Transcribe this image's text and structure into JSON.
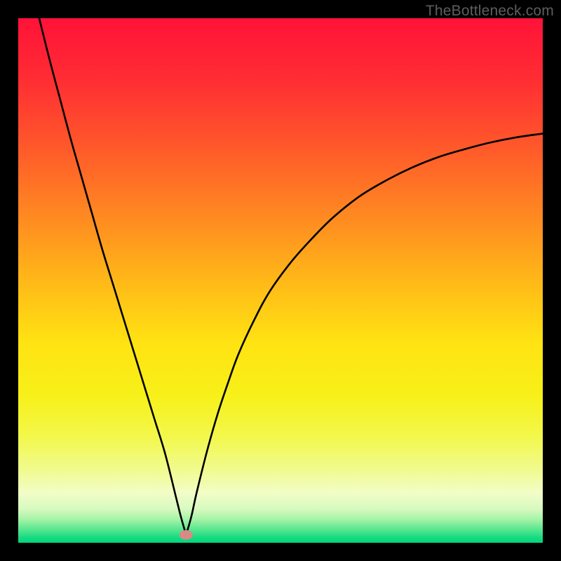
{
  "watermark": "TheBottleneck.com",
  "chart_data": {
    "type": "line",
    "title": "",
    "xlabel": "",
    "ylabel": "",
    "xlim": [
      0,
      100
    ],
    "ylim": [
      0,
      100
    ],
    "gradient_stops": [
      {
        "pos": 0.0,
        "color": "#ff1238"
      },
      {
        "pos": 0.12,
        "color": "#ff2e33"
      },
      {
        "pos": 0.25,
        "color": "#ff5a2a"
      },
      {
        "pos": 0.38,
        "color": "#ff8a21"
      },
      {
        "pos": 0.5,
        "color": "#ffb818"
      },
      {
        "pos": 0.62,
        "color": "#ffe312"
      },
      {
        "pos": 0.72,
        "color": "#f7f019"
      },
      {
        "pos": 0.8,
        "color": "#f3f84d"
      },
      {
        "pos": 0.86,
        "color": "#f0fb8e"
      },
      {
        "pos": 0.905,
        "color": "#f2fdc7"
      },
      {
        "pos": 0.935,
        "color": "#d8fac0"
      },
      {
        "pos": 0.955,
        "color": "#a7f3a8"
      },
      {
        "pos": 0.975,
        "color": "#57e68f"
      },
      {
        "pos": 0.99,
        "color": "#17db82"
      },
      {
        "pos": 1.0,
        "color": "#00d67b"
      }
    ],
    "minimum_x": 32,
    "marker": {
      "x": 32,
      "y": 1.5,
      "color": "#d98a87"
    },
    "series": [
      {
        "name": "bottleneck-curve",
        "x": [
          4,
          6,
          8,
          10,
          12,
          14,
          16,
          18,
          20,
          22,
          24,
          26,
          28,
          30,
          31,
          32,
          33,
          34,
          36,
          38,
          40,
          42,
          45,
          48,
          52,
          56,
          60,
          65,
          70,
          75,
          80,
          85,
          90,
          95,
          100
        ],
        "y": [
          100,
          92,
          84.5,
          77,
          70,
          63,
          56,
          49.5,
          43,
          36.5,
          30,
          23.5,
          17,
          9,
          5,
          1.5,
          5,
          9.5,
          17.5,
          24.5,
          30.5,
          36,
          42.5,
          48,
          53.5,
          58,
          62,
          66,
          69,
          71.5,
          73.5,
          75,
          76.3,
          77.3,
          78
        ]
      }
    ]
  }
}
